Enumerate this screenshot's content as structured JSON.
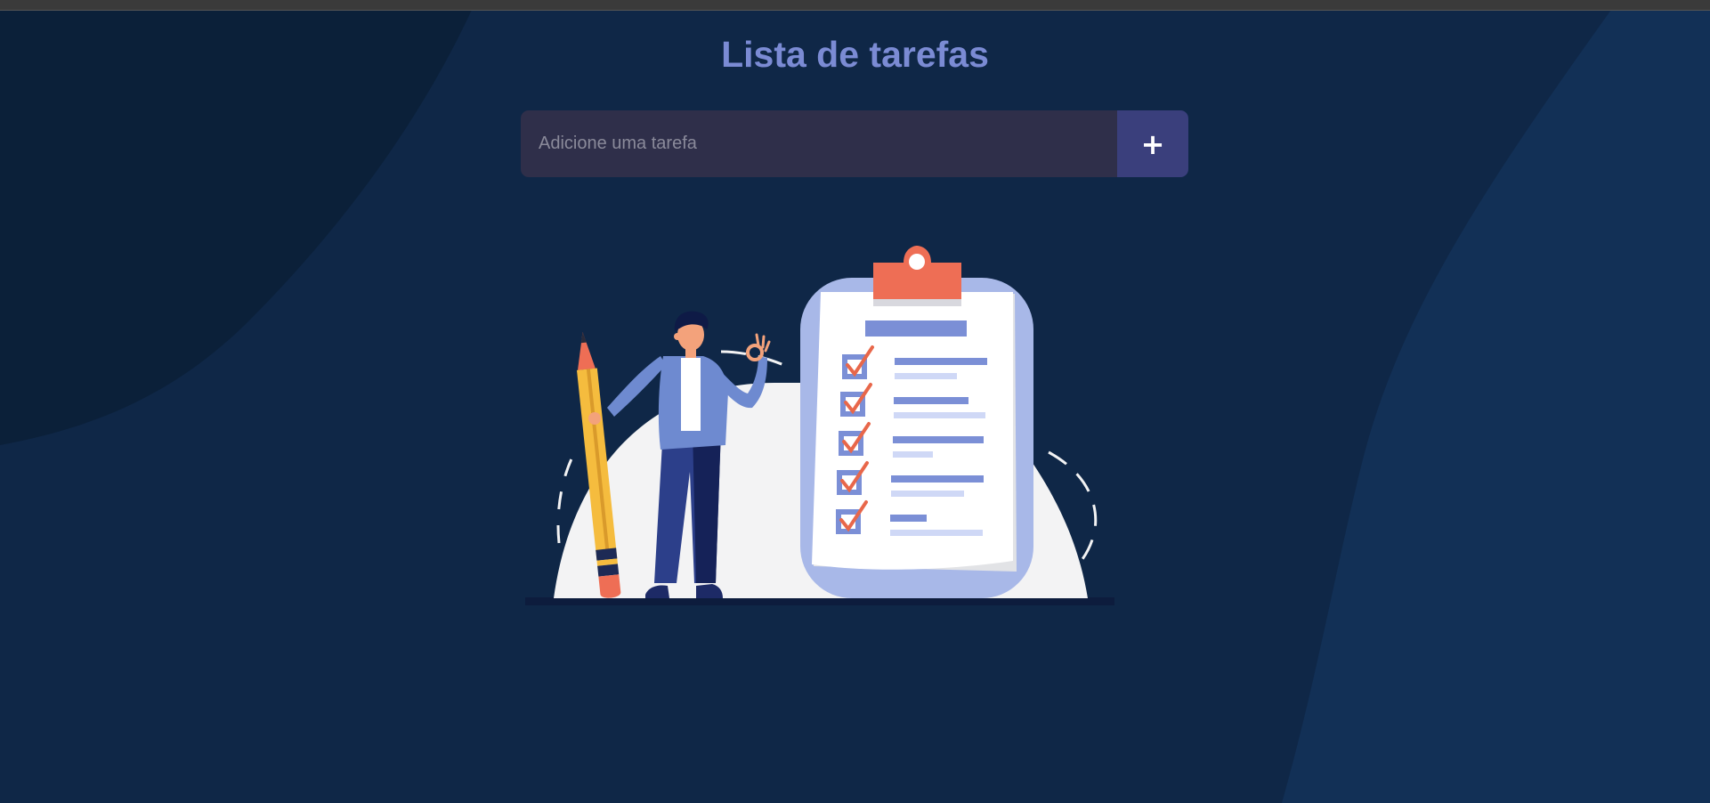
{
  "header": {
    "title": "Lista de tarefas"
  },
  "task_form": {
    "input_value": "",
    "input_placeholder": "Adicione uma tarefa",
    "add_button_label": "+"
  },
  "icons": {
    "add": "plus-icon",
    "illustration": "person-with-pencil-and-checklist-clipboard"
  },
  "colors": {
    "background": "#0f2747",
    "title": "#7b8bd4",
    "input_bg": "#2f2f4a",
    "button_bg": "#3a3f7c",
    "accent_check": "#e8674a",
    "clipboard": "#a8b8e8"
  }
}
